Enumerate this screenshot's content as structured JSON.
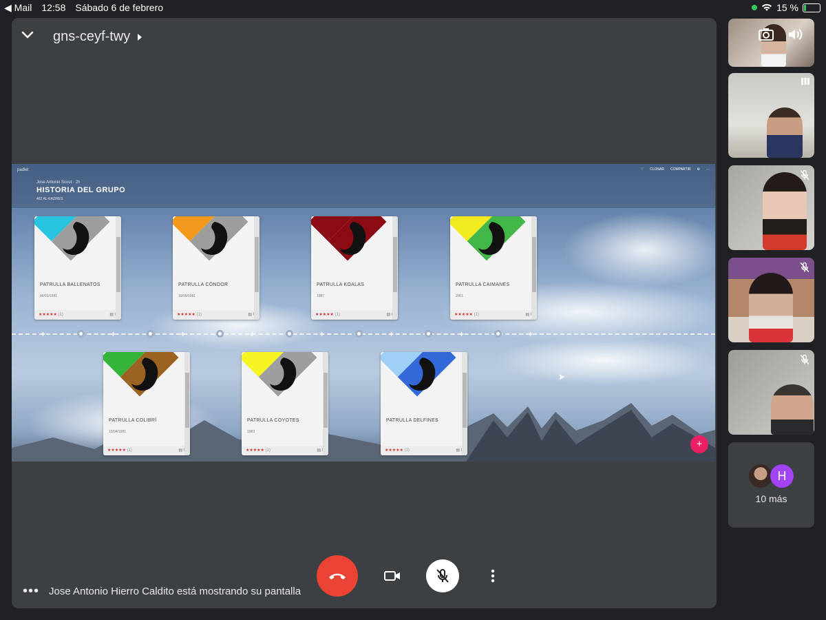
{
  "status": {
    "back_app": "Mail",
    "time": "12:58",
    "date": "Sábado 6 de febrero",
    "battery_text": "15 %",
    "battery_level": 0.15
  },
  "meeting": {
    "code": "gns-ceyf-twy"
  },
  "shared": {
    "brand": "padlet",
    "author": "Jose Antonio Scout",
    "author_time": "2h",
    "title": "HISTORIA DEL GRUPO",
    "subtitle": "462 AL-KAZIRES",
    "actions": {
      "clone": "CLONAR",
      "share": "COMPARTIR"
    },
    "fab": "+",
    "cards": [
      {
        "name": "PATRULLA BALLENATOS",
        "date": "06/01/1981",
        "stars": "★★★★★",
        "rating": "(1)",
        "comments": "0",
        "color_left": "#29c4e0",
        "color_right": "#9e9e9e"
      },
      {
        "name": "PATRULLA CÓNDOR",
        "date": "19/09/1981",
        "stars": "★★★★★",
        "rating": "(1)",
        "comments": "0",
        "color_left": "#f39a1c",
        "color_right": "#9e9e9e"
      },
      {
        "name": "PATRULLA KOALAS",
        "date": "1987",
        "stars": "★★★★★",
        "rating": "(1)",
        "comments": "0",
        "color_left": "#8b0a14",
        "color_right": "#8b0a14"
      },
      {
        "name": "PATRULLA CAIMANES",
        "date": "2001",
        "stars": "★★★★★",
        "rating": "(1)",
        "comments": "0",
        "color_left": "#f2ea21",
        "color_right": "#43b649"
      },
      {
        "name": "PATRULLA COLIBRÍ",
        "date": "15/04/1981",
        "stars": "★★★★★",
        "rating": "(1)",
        "comments": "0",
        "color_left": "#34b53a",
        "color_right": "#9c6222"
      },
      {
        "name": "PATRULLA COYOTES",
        "date": "1983",
        "stars": "★★★★★",
        "rating": "(1)",
        "comments": "0",
        "color_left": "#f6f423",
        "color_right": "#9e9e9e"
      },
      {
        "name": "PATRULLA DELFINES",
        "date": "",
        "stars": "★★★★★",
        "rating": "(1)",
        "comments": "0",
        "color_left": "#9fd1f7",
        "color_right": "#3268d8"
      }
    ]
  },
  "presenter_text": "Jose Antonio Hierro Caldito está mostrando su pantalla",
  "participants": {
    "more_label": "10 más",
    "more_initial": "H"
  },
  "colors": {
    "end_call": "#ea4335",
    "stage": "#3c4043",
    "background": "#202124",
    "avatar_h": "#a142f4",
    "fab": "#e91e63"
  },
  "icons": [
    "back-arrow-icon",
    "wifi-icon",
    "battery-icon",
    "chevron-down-icon",
    "caret-right-icon",
    "more-horizontal-icon",
    "hang-up-icon",
    "camera-icon",
    "mic-off-icon",
    "more-vertical-icon",
    "switch-camera-icon",
    "speaker-icon",
    "audio-level-icon"
  ]
}
